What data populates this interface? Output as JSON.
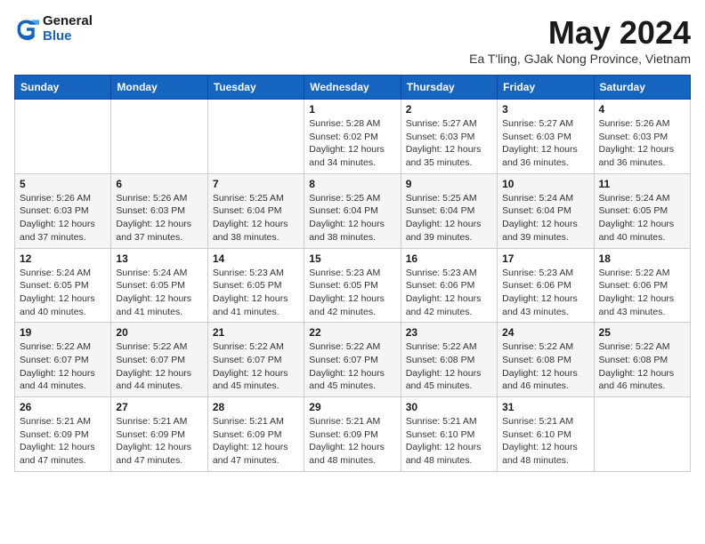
{
  "logo": {
    "line1": "General",
    "line2": "Blue"
  },
  "title": "May 2024",
  "location": "Ea T'ling, GJak Nong Province, Vietnam",
  "headers": [
    "Sunday",
    "Monday",
    "Tuesday",
    "Wednesday",
    "Thursday",
    "Friday",
    "Saturday"
  ],
  "weeks": [
    [
      {
        "day": "",
        "info": ""
      },
      {
        "day": "",
        "info": ""
      },
      {
        "day": "",
        "info": ""
      },
      {
        "day": "1",
        "info": "Sunrise: 5:28 AM\nSunset: 6:02 PM\nDaylight: 12 hours\nand 34 minutes."
      },
      {
        "day": "2",
        "info": "Sunrise: 5:27 AM\nSunset: 6:03 PM\nDaylight: 12 hours\nand 35 minutes."
      },
      {
        "day": "3",
        "info": "Sunrise: 5:27 AM\nSunset: 6:03 PM\nDaylight: 12 hours\nand 36 minutes."
      },
      {
        "day": "4",
        "info": "Sunrise: 5:26 AM\nSunset: 6:03 PM\nDaylight: 12 hours\nand 36 minutes."
      }
    ],
    [
      {
        "day": "5",
        "info": "Sunrise: 5:26 AM\nSunset: 6:03 PM\nDaylight: 12 hours\nand 37 minutes."
      },
      {
        "day": "6",
        "info": "Sunrise: 5:26 AM\nSunset: 6:03 PM\nDaylight: 12 hours\nand 37 minutes."
      },
      {
        "day": "7",
        "info": "Sunrise: 5:25 AM\nSunset: 6:04 PM\nDaylight: 12 hours\nand 38 minutes."
      },
      {
        "day": "8",
        "info": "Sunrise: 5:25 AM\nSunset: 6:04 PM\nDaylight: 12 hours\nand 38 minutes."
      },
      {
        "day": "9",
        "info": "Sunrise: 5:25 AM\nSunset: 6:04 PM\nDaylight: 12 hours\nand 39 minutes."
      },
      {
        "day": "10",
        "info": "Sunrise: 5:24 AM\nSunset: 6:04 PM\nDaylight: 12 hours\nand 39 minutes."
      },
      {
        "day": "11",
        "info": "Sunrise: 5:24 AM\nSunset: 6:05 PM\nDaylight: 12 hours\nand 40 minutes."
      }
    ],
    [
      {
        "day": "12",
        "info": "Sunrise: 5:24 AM\nSunset: 6:05 PM\nDaylight: 12 hours\nand 40 minutes."
      },
      {
        "day": "13",
        "info": "Sunrise: 5:24 AM\nSunset: 6:05 PM\nDaylight: 12 hours\nand 41 minutes."
      },
      {
        "day": "14",
        "info": "Sunrise: 5:23 AM\nSunset: 6:05 PM\nDaylight: 12 hours\nand 41 minutes."
      },
      {
        "day": "15",
        "info": "Sunrise: 5:23 AM\nSunset: 6:05 PM\nDaylight: 12 hours\nand 42 minutes."
      },
      {
        "day": "16",
        "info": "Sunrise: 5:23 AM\nSunset: 6:06 PM\nDaylight: 12 hours\nand 42 minutes."
      },
      {
        "day": "17",
        "info": "Sunrise: 5:23 AM\nSunset: 6:06 PM\nDaylight: 12 hours\nand 43 minutes."
      },
      {
        "day": "18",
        "info": "Sunrise: 5:22 AM\nSunset: 6:06 PM\nDaylight: 12 hours\nand 43 minutes."
      }
    ],
    [
      {
        "day": "19",
        "info": "Sunrise: 5:22 AM\nSunset: 6:07 PM\nDaylight: 12 hours\nand 44 minutes."
      },
      {
        "day": "20",
        "info": "Sunrise: 5:22 AM\nSunset: 6:07 PM\nDaylight: 12 hours\nand 44 minutes."
      },
      {
        "day": "21",
        "info": "Sunrise: 5:22 AM\nSunset: 6:07 PM\nDaylight: 12 hours\nand 45 minutes."
      },
      {
        "day": "22",
        "info": "Sunrise: 5:22 AM\nSunset: 6:07 PM\nDaylight: 12 hours\nand 45 minutes."
      },
      {
        "day": "23",
        "info": "Sunrise: 5:22 AM\nSunset: 6:08 PM\nDaylight: 12 hours\nand 45 minutes."
      },
      {
        "day": "24",
        "info": "Sunrise: 5:22 AM\nSunset: 6:08 PM\nDaylight: 12 hours\nand 46 minutes."
      },
      {
        "day": "25",
        "info": "Sunrise: 5:22 AM\nSunset: 6:08 PM\nDaylight: 12 hours\nand 46 minutes."
      }
    ],
    [
      {
        "day": "26",
        "info": "Sunrise: 5:21 AM\nSunset: 6:09 PM\nDaylight: 12 hours\nand 47 minutes."
      },
      {
        "day": "27",
        "info": "Sunrise: 5:21 AM\nSunset: 6:09 PM\nDaylight: 12 hours\nand 47 minutes."
      },
      {
        "day": "28",
        "info": "Sunrise: 5:21 AM\nSunset: 6:09 PM\nDaylight: 12 hours\nand 47 minutes."
      },
      {
        "day": "29",
        "info": "Sunrise: 5:21 AM\nSunset: 6:09 PM\nDaylight: 12 hours\nand 48 minutes."
      },
      {
        "day": "30",
        "info": "Sunrise: 5:21 AM\nSunset: 6:10 PM\nDaylight: 12 hours\nand 48 minutes."
      },
      {
        "day": "31",
        "info": "Sunrise: 5:21 AM\nSunset: 6:10 PM\nDaylight: 12 hours\nand 48 minutes."
      },
      {
        "day": "",
        "info": ""
      }
    ]
  ]
}
